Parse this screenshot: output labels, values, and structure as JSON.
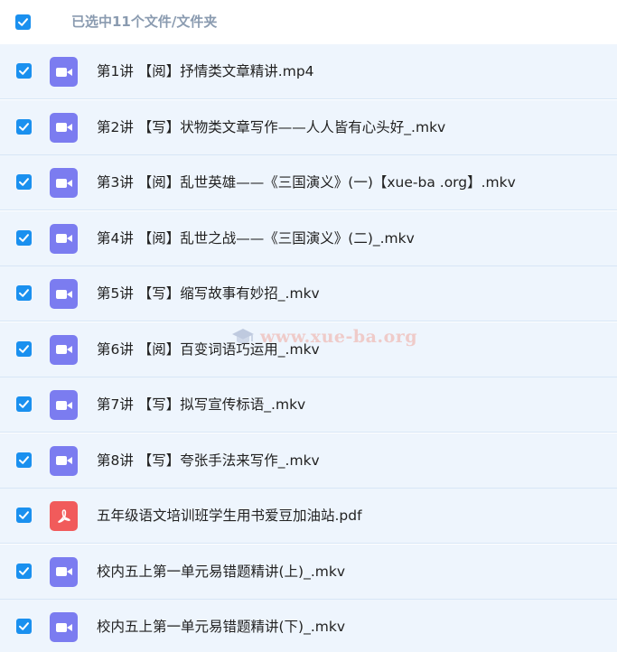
{
  "header": {
    "title": "已选中11个文件/文件夹",
    "checked": true
  },
  "colors": {
    "checkbox": "#1a90ef",
    "video_icon": "#7b7cf0",
    "pdf_icon": "#f15b5b",
    "row_bg": "#eef5fd"
  },
  "files": [
    {
      "name": "第1讲 【阅】抒情类文章精讲.mp4",
      "icon": "video-icon",
      "checked": true
    },
    {
      "name": "第2讲 【写】状物类文章写作——人人皆有心头好_.mkv",
      "icon": "video-icon",
      "checked": true
    },
    {
      "name": "第3讲 【阅】乱世英雄——《三国演义》(一)【xue-ba .org】.mkv",
      "icon": "video-icon",
      "checked": true
    },
    {
      "name": "第4讲 【阅】乱世之战——《三国演义》(二)_.mkv",
      "icon": "video-icon",
      "checked": true
    },
    {
      "name": "第5讲 【写】缩写故事有妙招_.mkv",
      "icon": "video-icon",
      "checked": true
    },
    {
      "name": "第6讲 【阅】百变词语巧运用_.mkv",
      "icon": "video-icon",
      "checked": true
    },
    {
      "name": "第7讲 【写】拟写宣传标语_.mkv",
      "icon": "video-icon",
      "checked": true
    },
    {
      "name": "第8讲 【写】夸张手法来写作_.mkv",
      "icon": "video-icon",
      "checked": true
    },
    {
      "name": "五年级语文培训班学生用书爱豆加油站.pdf",
      "icon": "pdf-icon",
      "checked": true
    },
    {
      "name": "校内五上第一单元易错题精讲(上)_.mkv",
      "icon": "video-icon",
      "checked": true
    },
    {
      "name": "校内五上第一单元易错题精讲(下)_.mkv",
      "icon": "video-icon",
      "checked": true
    }
  ],
  "watermark": {
    "text": "www.xue-ba.org",
    "icon": "graduation-cap-icon"
  }
}
